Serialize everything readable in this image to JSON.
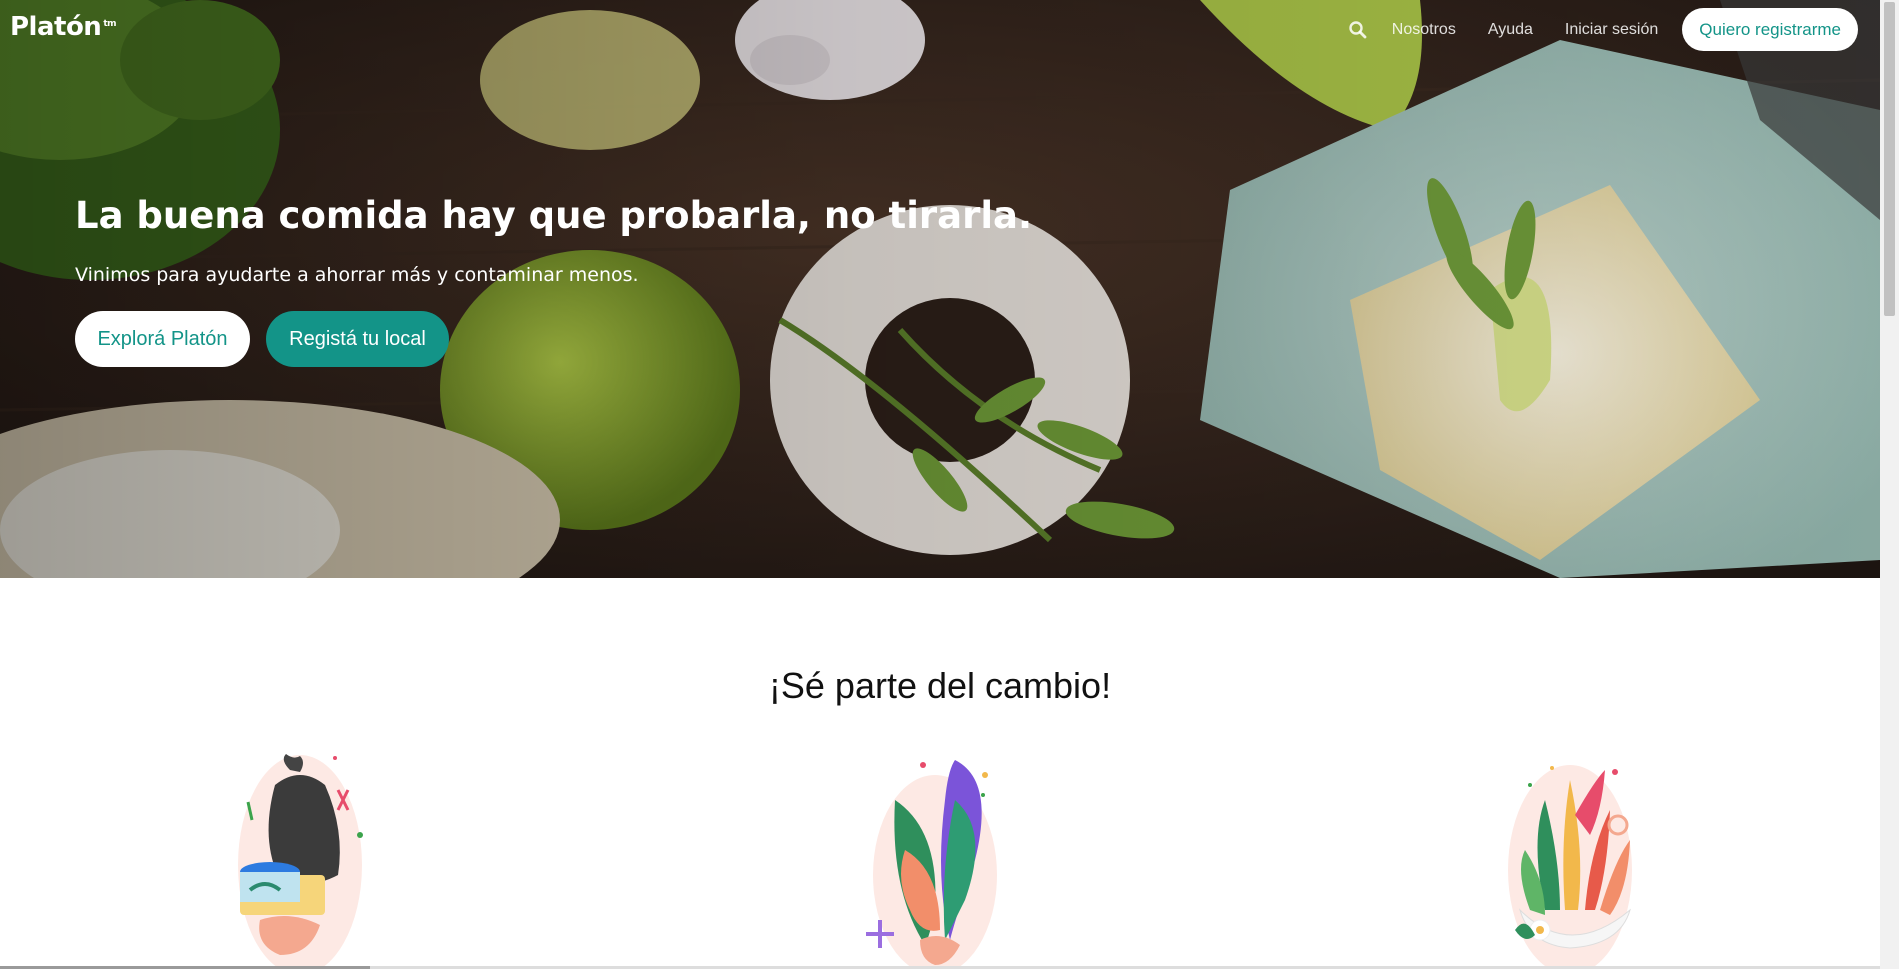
{
  "brand": {
    "logo_text": "Platón",
    "logo_mark": "tm",
    "teal": "#139488"
  },
  "nav": {
    "search_icon": "search-icon",
    "links": [
      "Nosotros",
      "Ayuda",
      "Iniciar sesión"
    ],
    "cta_label": "Quiero registrarme"
  },
  "hero": {
    "title": "La buena comida hay que probarla, no tirarla.",
    "subtitle": "Vinimos para ayudarte a ahorrar más y contaminar menos.",
    "primary_button": "Explorá Platón",
    "secondary_button": "Registá tu local"
  },
  "section": {
    "title": "¡Sé parte del cambio!",
    "illustrations": [
      "trash-bag-and-food-container-illustration",
      "leaves-plant-illustration",
      "salad-bowl-illustration"
    ]
  }
}
